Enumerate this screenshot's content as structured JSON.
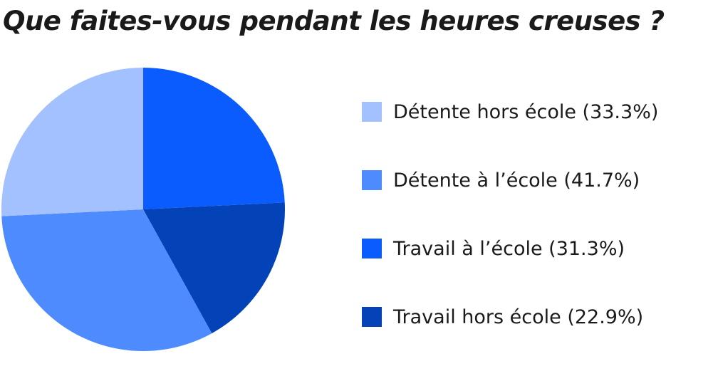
{
  "chart_data": {
    "type": "pie",
    "title": "Que faites-vous pendant les heures creuses ?",
    "slices": [
      {
        "label": "Détente hors école (33.3%)",
        "value": 33.3,
        "color": "#a3c1ff"
      },
      {
        "label": "Détente à l’école (41.7%)",
        "value": 41.7,
        "color": "#4d8bff"
      },
      {
        "label": "Travail à l’école (31.3%)",
        "value": 31.3,
        "color": "#0a5cff"
      },
      {
        "label": "Travail hors école (22.9%)",
        "value": 22.9,
        "color": "#0442b8"
      }
    ],
    "legend_position": "right"
  }
}
